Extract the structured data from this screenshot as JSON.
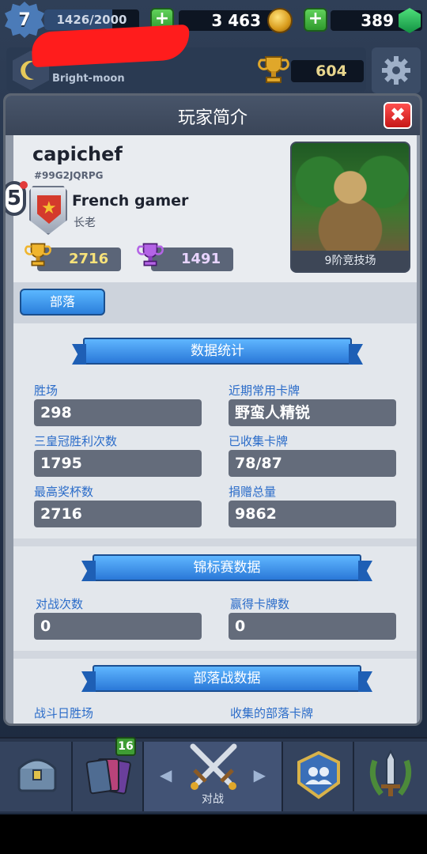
{
  "topbar": {
    "level": "7",
    "xp": "1426/2000",
    "xp_fraction": 0.713,
    "gold": "3 463",
    "gems": "389",
    "plus_symbol": "+",
    "clan_name": "Bright-moon",
    "trophies": "604"
  },
  "modal": {
    "title": "玩家简介",
    "close_symbol": "✖"
  },
  "profile": {
    "name": "capichef",
    "tag": "#99G2JQRPG",
    "level_bubble": "5",
    "clan_name": "French gamer",
    "clan_role": "长老",
    "trophies": "2716",
    "best_trophies": "1491",
    "arena_label": "9阶竞技场"
  },
  "clan_button": "部落",
  "stats": {
    "header": "数据统计",
    "fields": [
      {
        "label": "胜场",
        "value": "298"
      },
      {
        "label": "近期常用卡牌",
        "value": "野蛮人精锐"
      },
      {
        "label": "三皇冠胜利次数",
        "value": "1795"
      },
      {
        "label": "已收集卡牌",
        "value": "78/87"
      },
      {
        "label": "最高奖杯数",
        "value": "2716"
      },
      {
        "label": "捐赠总量",
        "value": "9862"
      }
    ]
  },
  "tournament": {
    "header": "锦标赛数据",
    "fields": [
      {
        "label": "对战次数",
        "value": "0"
      },
      {
        "label": "赢得卡牌数",
        "value": "0"
      }
    ]
  },
  "clanwar": {
    "header": "部落战数据",
    "fields": [
      {
        "label": "战斗日胜场"
      },
      {
        "label": "收集的部落卡牌"
      }
    ]
  },
  "nav": {
    "cards_badge": "16",
    "battle_label": "对战",
    "arrow_left": "◀",
    "arrow_right": "▶"
  }
}
